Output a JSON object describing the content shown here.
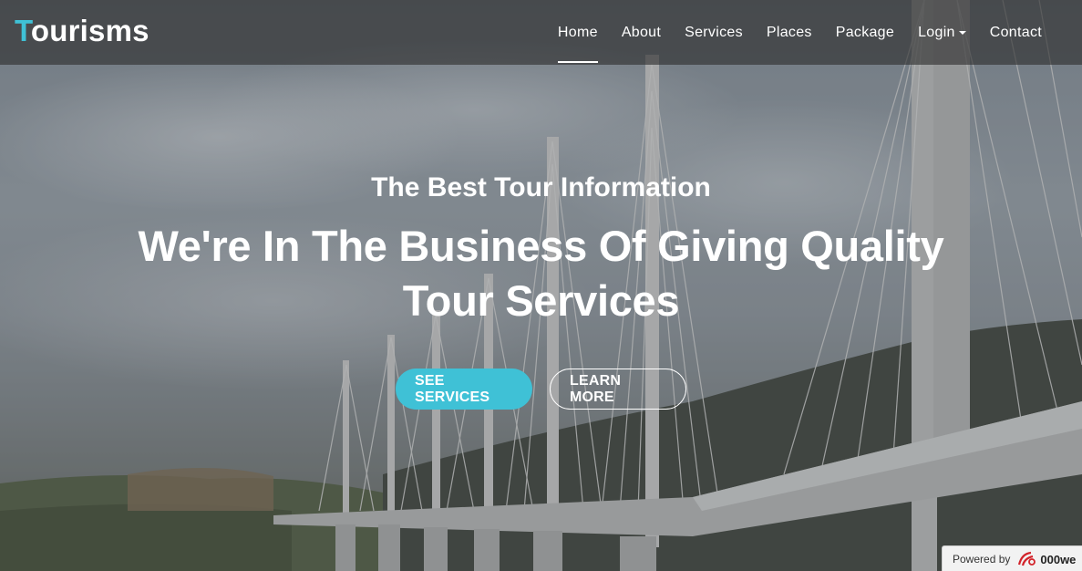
{
  "brand": {
    "first_letter": "T",
    "rest": "ourisms"
  },
  "nav": {
    "items": [
      {
        "label": "Home",
        "active": true
      },
      {
        "label": "About"
      },
      {
        "label": "Services"
      },
      {
        "label": "Places"
      },
      {
        "label": "Package"
      },
      {
        "label": "Login",
        "has_dropdown": true
      },
      {
        "label": "Contact"
      }
    ]
  },
  "hero": {
    "kicker": "The Best Tour Information",
    "headline": "We're In The Business Of Giving Quality Tour Services",
    "primary_button": "SEE SERVICES",
    "secondary_button": "LEARN MORE"
  },
  "powered_by": {
    "label": "Powered by",
    "brand": "000we"
  },
  "colors": {
    "accent": "#3fc1d6",
    "nav_bg": "rgba(45,45,45,0.62)",
    "text": "#ffffff"
  }
}
